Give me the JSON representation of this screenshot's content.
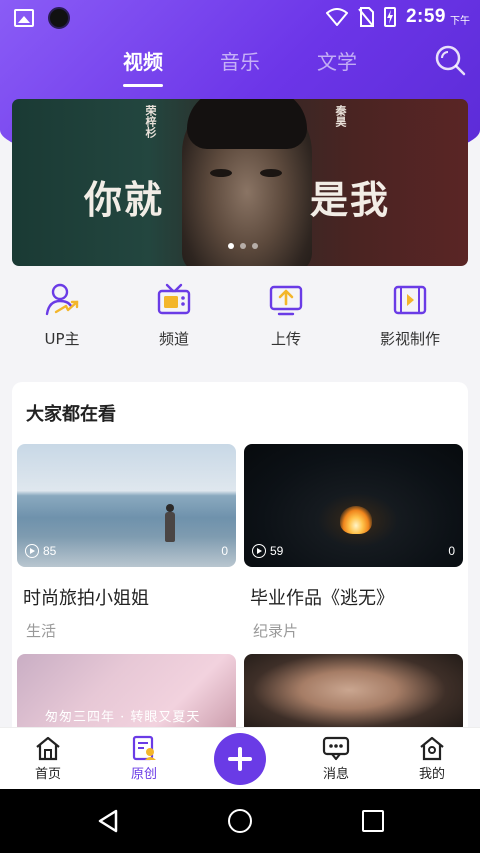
{
  "status_bar": {
    "time": "2:59",
    "ampm": "下午"
  },
  "top_tabs": [
    {
      "label": "视频",
      "active": true
    },
    {
      "label": "音乐",
      "active": false
    },
    {
      "label": "文学",
      "active": false
    }
  ],
  "banner": {
    "title_left": "你就",
    "title_right": "是我",
    "name_left": "荣梓杉",
    "name_right": "秦昊",
    "slide_count": 3,
    "active_slide": 0
  },
  "quick_actions": [
    {
      "label": "UP主",
      "icon": "up-master-icon"
    },
    {
      "label": "频道",
      "icon": "tv-channel-icon"
    },
    {
      "label": "上传",
      "icon": "upload-icon"
    },
    {
      "label": "影视制作",
      "icon": "film-production-icon"
    }
  ],
  "section": {
    "title": "大家都在看",
    "videos": [
      {
        "title": "时尚旅拍小姐姐",
        "category": "生活",
        "plays": "85",
        "comments": "0"
      },
      {
        "title": "毕业作品《逃无》",
        "category": "纪录片",
        "plays": "59",
        "comments": "0"
      },
      {
        "overlay_text": "匆匆三四年 · 转眼又夏天"
      },
      {
        "title": ""
      }
    ]
  },
  "bottom_nav": [
    {
      "label": "首页",
      "icon": "home-icon",
      "active": false
    },
    {
      "label": "原创",
      "icon": "original-icon",
      "active": true
    },
    {
      "label": "消息",
      "icon": "message-icon",
      "active": false
    },
    {
      "label": "我的",
      "icon": "profile-icon",
      "active": false
    }
  ],
  "colors": {
    "accent": "#6a3be6",
    "header_start": "#8a5cf6",
    "header_end": "#5b2bd6"
  }
}
